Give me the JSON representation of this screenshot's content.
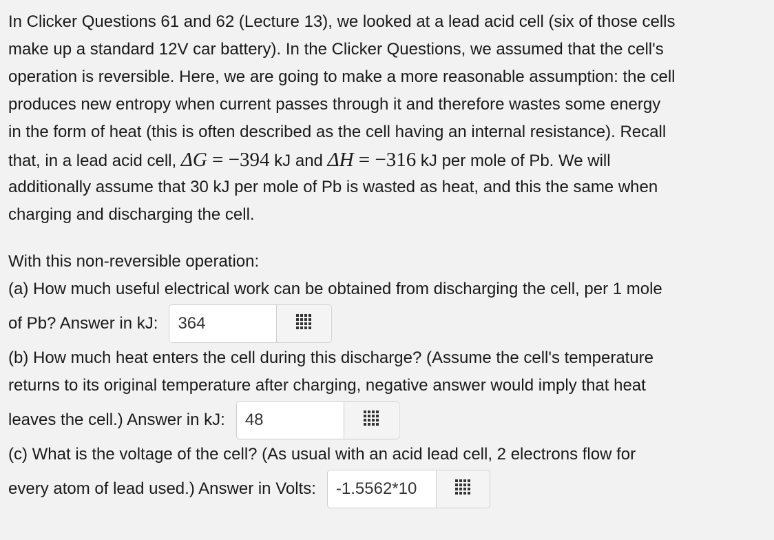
{
  "intro": {
    "line1": "In Clicker Questions 61 and 62 (Lecture 13), we looked at a lead acid cell (six of those cells",
    "line2": "make up a standard 12V car battery). In the Clicker Questions, we assumed that the cell's",
    "line3": "operation is reversible. Here, we are going to make a more reasonable assumption: the cell",
    "line4": "produces new entropy when current passes through it and therefore wastes some energy",
    "line5": "in the form of heat (this is often described as the cell having an internal resistance). Recall",
    "line6_pre": "that, in a lead acid cell, ",
    "delta_g_sym": "ΔG",
    "delta_g_val": " = −394",
    "line6_mid": " kJ and ",
    "delta_h_sym": "ΔH",
    "delta_h_val": " = −316",
    "line6_post": " kJ per mole of Pb. We will",
    "line7": "additionally assume that 30 kJ per mole of Pb is wasted as heat, and this the same when",
    "line8": "charging and discharging the cell."
  },
  "lead_in": "With this non-reversible operation:",
  "questions": {
    "a": {
      "line1": "(a) How much useful electrical work can be obtained from discharging the cell, per 1 mole",
      "label": "of Pb? Answer in kJ:",
      "value": "364"
    },
    "b": {
      "line1": "(b) How much heat enters the cell during this discharge? (Assume the cell's temperature",
      "line2": "returns to its original temperature after charging, negative answer would imply that heat",
      "label": "leaves the cell.) Answer in kJ:",
      "value": "48"
    },
    "c": {
      "line1": "(c) What is the voltage of the cell? (As usual with an acid lead cell, 2 electrons flow for",
      "label": "every atom of lead used.) Answer in Volts:",
      "value": "-1.5562*10"
    }
  },
  "colors": {
    "background": "#f2f2f2",
    "text": "#1a1a1a",
    "input_border": "#cfcfcf"
  },
  "icons": {
    "palette": "grid-palette-icon"
  }
}
